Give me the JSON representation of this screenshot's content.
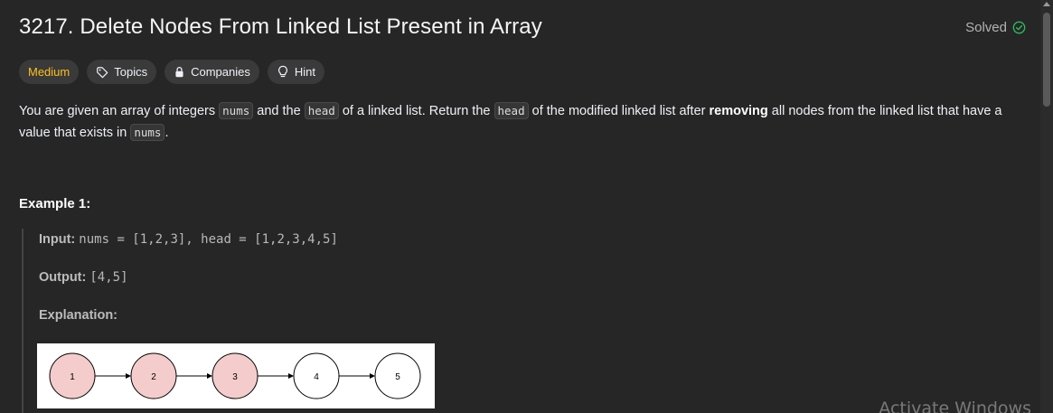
{
  "problem": {
    "title": "3217. Delete Nodes From Linked List Present in Array",
    "status": "Solved"
  },
  "tags": {
    "difficulty": "Medium",
    "topics": "Topics",
    "companies": "Companies",
    "hint": "Hint"
  },
  "description": {
    "p1": "You are given an array of integers",
    "code_nums": "nums",
    "p2": "and the",
    "code_head": "head",
    "p3": "of a linked list. Return the",
    "p4": "of the modified linked list after",
    "bold": "removing",
    "p5": "all nodes from the linked list that have a value that exists in",
    "p6": "."
  },
  "example": {
    "title": "Example 1:",
    "input_label": "Input:",
    "input_value": "nums = [1,2,3], head = [1,2,3,4,5]",
    "output_label": "Output:",
    "output_value": "[4,5]",
    "explanation_label": "Explanation:"
  },
  "diagram": {
    "nodes": [
      {
        "label": "1",
        "removed": true
      },
      {
        "label": "2",
        "removed": true
      },
      {
        "label": "3",
        "removed": true
      },
      {
        "label": "4",
        "removed": false
      },
      {
        "label": "5",
        "removed": false
      }
    ],
    "removed_fill": "#f4cccc",
    "kept_fill": "#ffffff"
  },
  "watermark": "Activate Windows",
  "colors": {
    "background": "#262626",
    "difficulty_medium": "#ffc01e",
    "solved_check": "#2cbb5d"
  }
}
